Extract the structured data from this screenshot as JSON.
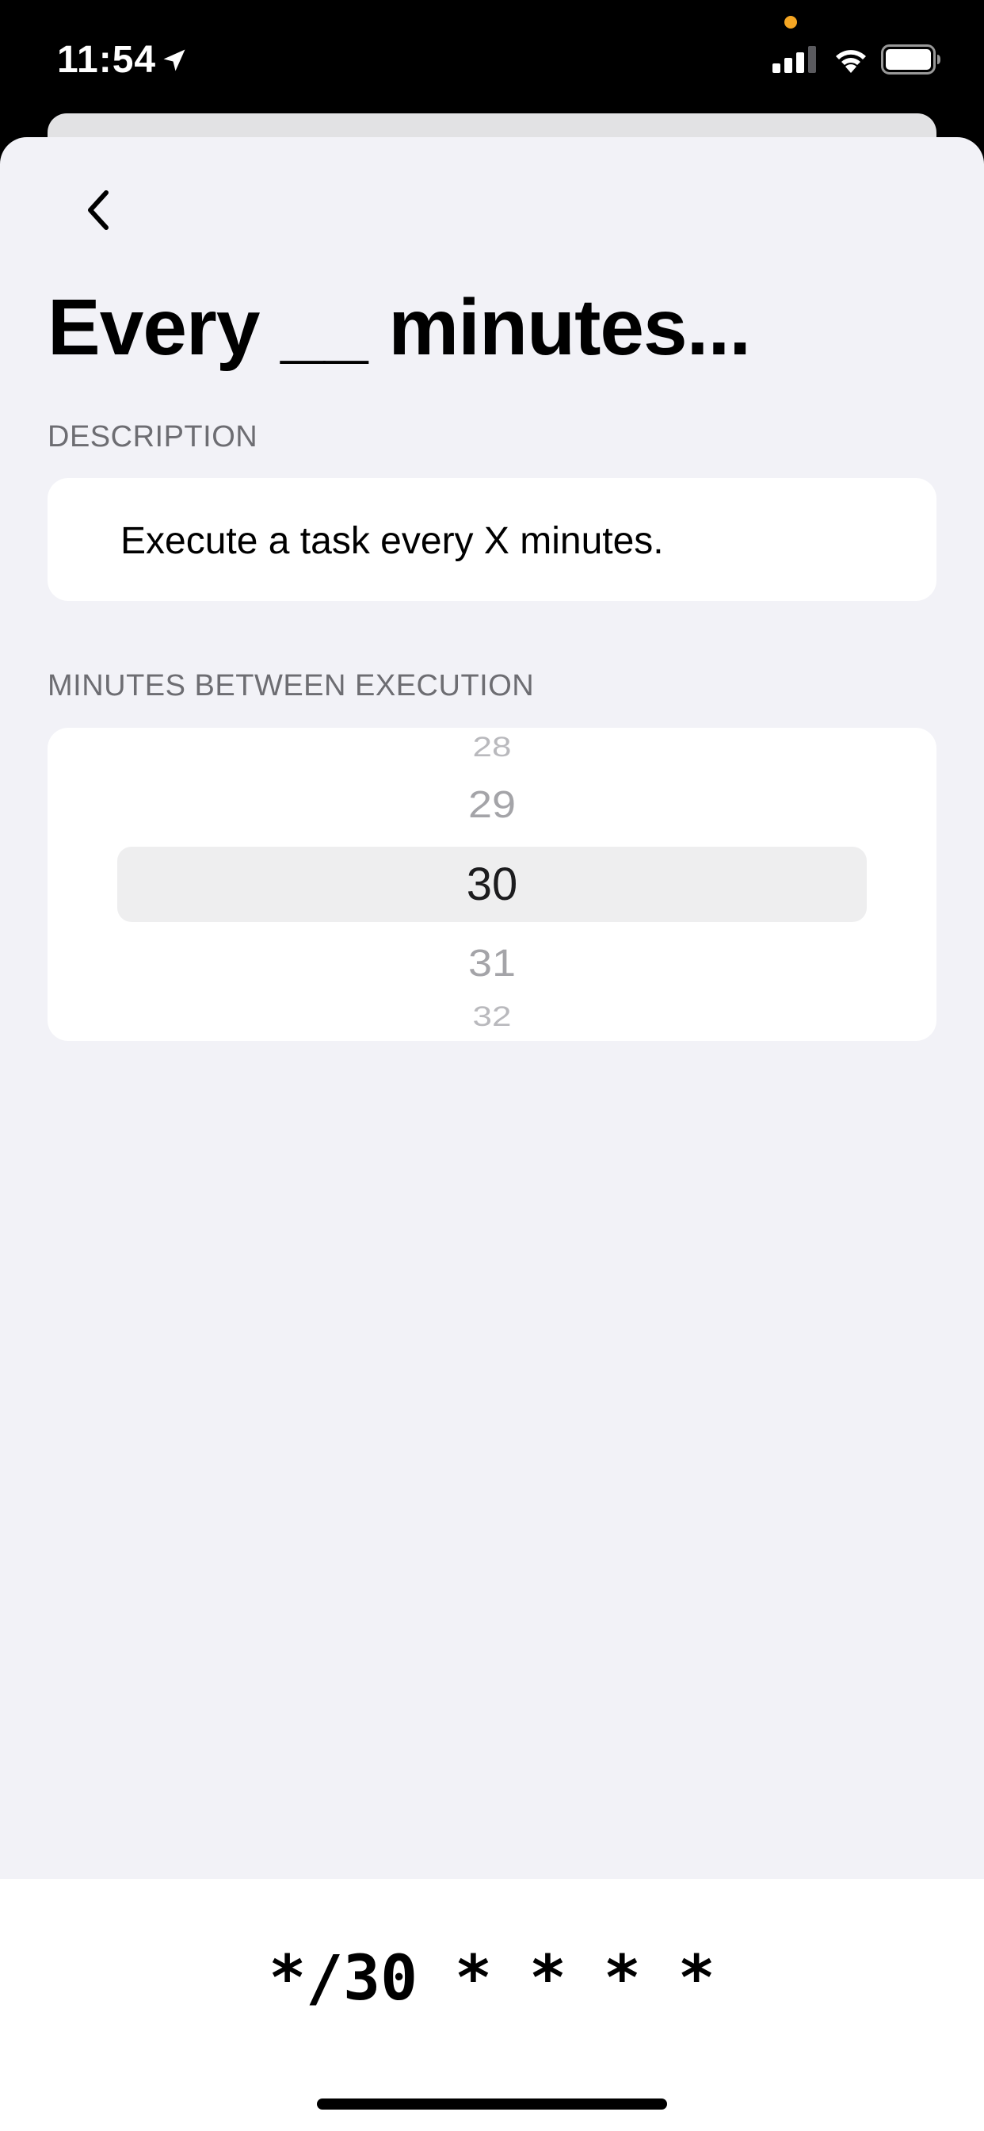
{
  "status_bar": {
    "time": "11:54",
    "icons": [
      "location-arrow-icon",
      "cellular-signal-icon",
      "wifi-icon",
      "battery-icon"
    ],
    "privacy_dot_color": "#f5a623"
  },
  "navigation": {
    "back_icon": "chevron-left-icon"
  },
  "page": {
    "title": "Every __ minutes..."
  },
  "description_section": {
    "header": "DESCRIPTION",
    "text": "Execute a task every X minutes."
  },
  "minutes_section": {
    "header": "MINUTES BETWEEN EXECUTION",
    "picker": {
      "visible_values": [
        "28",
        "29",
        "30",
        "31",
        "32"
      ],
      "selected_value": "30"
    }
  },
  "cron": {
    "expression": "*/30 * * * *"
  },
  "colors": {
    "sheet_background": "#f2f2f7",
    "card_background": "#ffffff",
    "section_header": "#6d6d72",
    "picker_selection": "#eeeeef",
    "status_bar_background": "#000000"
  }
}
